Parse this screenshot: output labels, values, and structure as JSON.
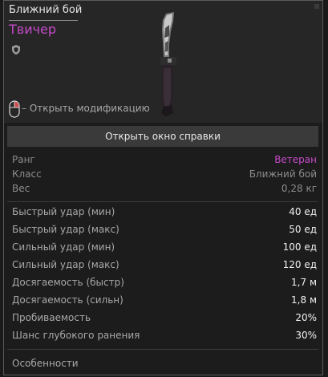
{
  "item": {
    "category": "Ближний бой",
    "name": "Твичер",
    "hint": "– Открыть модификацию"
  },
  "help_button": "Открыть окно справки",
  "info": [
    {
      "label": "Ранг",
      "value": "Ветеран"
    },
    {
      "label": "Класс",
      "value": "Ближний бой"
    },
    {
      "label": "Вес",
      "value": "0,28 кг"
    }
  ],
  "stats": [
    {
      "label": "Быстрый удар (мин)",
      "value": "40 ед"
    },
    {
      "label": "Быстрый удар (макс)",
      "value": "50 ед"
    },
    {
      "label": "Сильный удар (мин)",
      "value": "100 ед"
    },
    {
      "label": "Сильный удар (макс)",
      "value": "120 ед"
    },
    {
      "label": "Досягаемость (быстр)",
      "value": "1,7 м"
    },
    {
      "label": "Досягаемость (сильн)",
      "value": "1,8 м"
    },
    {
      "label": "Пробиваемость",
      "value": "20%"
    },
    {
      "label": "Шанс глубокого ранения",
      "value": "30%"
    }
  ],
  "features_label": "Особенности",
  "colors": {
    "rank": "#c64ac8",
    "name": "#c64ac8"
  },
  "icons": {
    "shield": "shield-icon",
    "mouse": "mouse-right-click-icon",
    "weapon": "knife-image"
  }
}
